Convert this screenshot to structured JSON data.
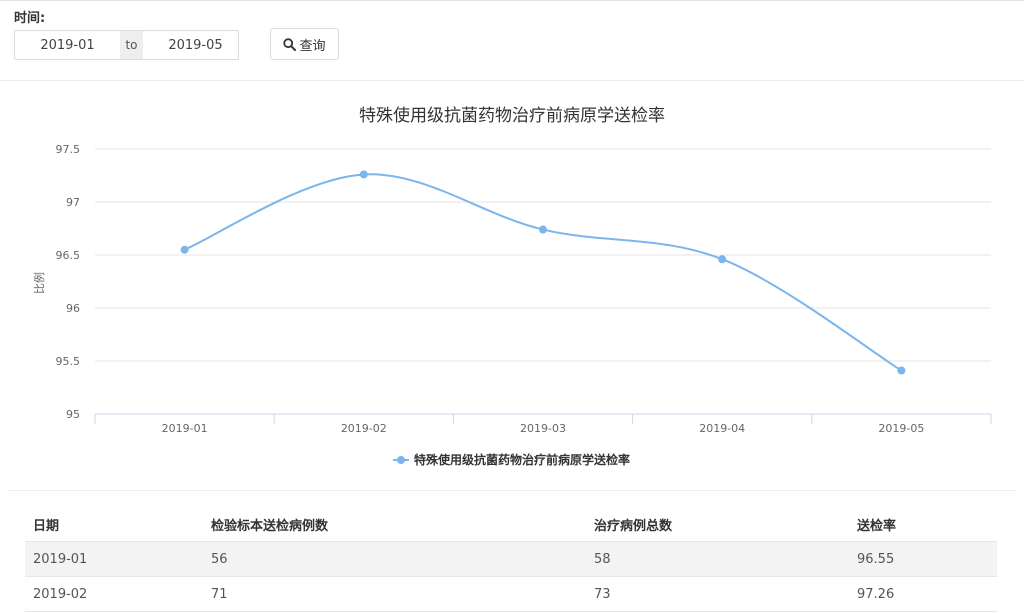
{
  "filter": {
    "label": "时间:",
    "start": "2019-01",
    "separator": "to",
    "end": "2019-05",
    "query_label": "查询"
  },
  "colors": {
    "series": "#7cb5ec",
    "grid": "#e6e6e6"
  },
  "chart_data": {
    "type": "line",
    "title": "特殊使用级抗菌药物治疗前病原学送检率",
    "xlabel": "",
    "ylabel": "比例",
    "categories": [
      "2019-01",
      "2019-02",
      "2019-03",
      "2019-04",
      "2019-05"
    ],
    "ylim": [
      95,
      97.5
    ],
    "yticks": [
      "95",
      "95.5",
      "96",
      "96.5",
      "97",
      "97.5"
    ],
    "series": [
      {
        "name": "特殊使用级抗菌药物治疗前病原学送检率",
        "values": [
          96.55,
          97.26,
          96.74,
          96.46,
          95.41
        ]
      }
    ],
    "grid": true,
    "legend": "bottom-center"
  },
  "table": {
    "headers": [
      "日期",
      "检验标本送检病例数",
      "治疗病例总数",
      "送检率"
    ],
    "rows": [
      [
        "2019-01",
        "56",
        "58",
        "96.55"
      ],
      [
        "2019-02",
        "71",
        "73",
        "97.26"
      ]
    ]
  }
}
